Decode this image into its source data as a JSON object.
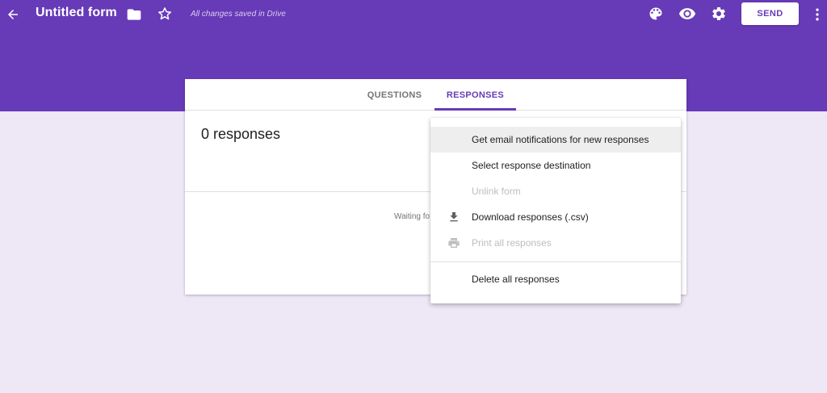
{
  "header": {
    "title": "Untitled form",
    "saved_status": "All changes saved in Drive",
    "send_label": "SEND",
    "icons": [
      "back-arrow-icon",
      "folder-icon",
      "star-icon",
      "palette-icon",
      "eye-icon",
      "gear-icon",
      "more-vert-icon"
    ]
  },
  "tabs": [
    {
      "label": "QUESTIONS",
      "active": false
    },
    {
      "label": "RESPONSES",
      "active": true
    }
  ],
  "card": {
    "responses_count": "0 responses",
    "waiting_text": "Waiting fo"
  },
  "menu": {
    "items": [
      {
        "label": "Get email notifications for new responses",
        "enabled": true,
        "icon": ""
      },
      {
        "label": "Select response destination",
        "enabled": true,
        "icon": ""
      },
      {
        "label": "Unlink form",
        "enabled": false,
        "icon": ""
      },
      {
        "label": "Download responses (.csv)",
        "enabled": true,
        "icon": "download-icon"
      },
      {
        "label": "Print all responses",
        "enabled": false,
        "icon": "print-icon"
      },
      {
        "label": "Delete all responses",
        "enabled": true,
        "icon": ""
      }
    ]
  },
  "colors": {
    "brand": "#673ab7",
    "page_background": "#ede7f6"
  }
}
